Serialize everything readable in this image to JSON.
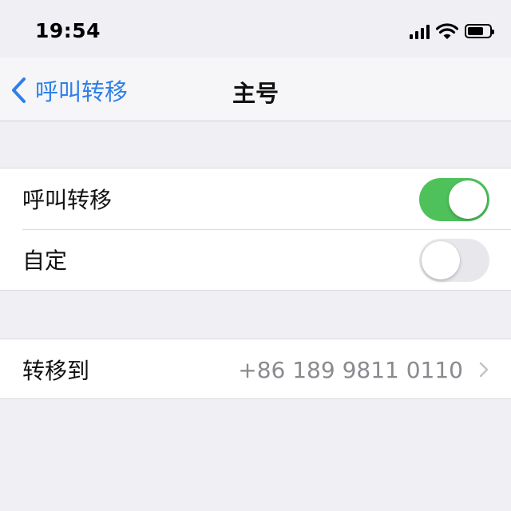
{
  "status_bar": {
    "time": "19:54",
    "icons": [
      "signal-icon",
      "wifi-icon",
      "battery-icon"
    ],
    "battery_level": 0.72
  },
  "nav": {
    "back_label": "呼叫转移",
    "title": "主号"
  },
  "settings": {
    "call_forwarding": {
      "label": "呼叫转移",
      "enabled": true
    },
    "custom": {
      "label": "自定",
      "enabled": false
    },
    "forward_to": {
      "label": "转移到",
      "value": "+86 189 9811 0110"
    }
  },
  "colors": {
    "accent": "#2f80e8",
    "toggle_on": "#4ec15b",
    "toggle_off": "#e8e8ec",
    "secondary_text": "#8a8a8f",
    "background": "#efeff4"
  }
}
